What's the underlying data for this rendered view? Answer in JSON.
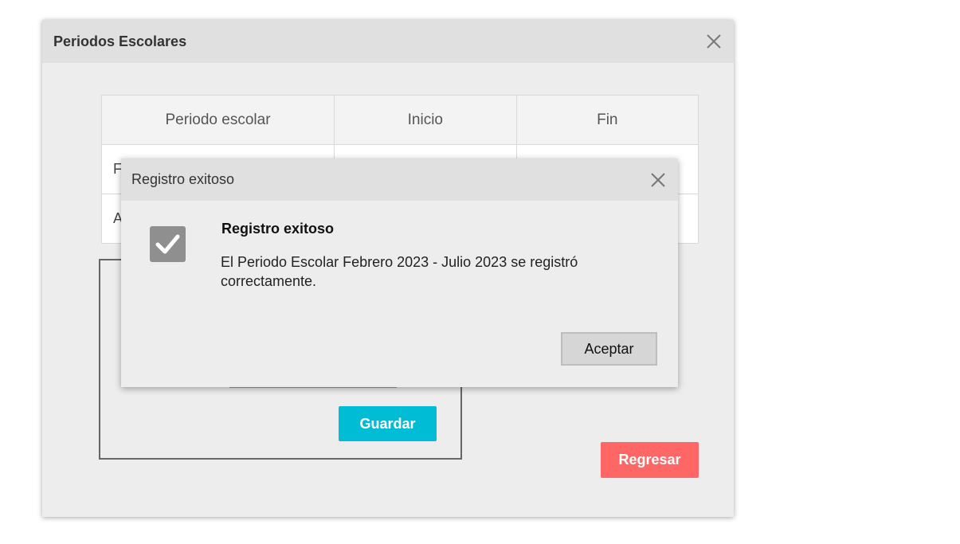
{
  "main_window": {
    "title": "Periodos Escolares",
    "close_icon": "close-icon",
    "table": {
      "headers": [
        "Periodo escolar",
        "Inicio",
        "Fin"
      ],
      "rows": [
        [
          "F",
          "",
          ""
        ],
        [
          "A",
          "",
          ""
        ]
      ]
    },
    "guardar_label": "Guardar",
    "regresar_label": "Regresar"
  },
  "dialog": {
    "title": "Registro exitoso",
    "close_icon": "close-icon",
    "check_icon": "checkbox-checked-icon",
    "message_title": "Registro exitoso",
    "message_body": "El Periodo Escolar Febrero 2023 - Julio 2023 se registró correctamente.",
    "accept_label": "Aceptar"
  },
  "colors": {
    "guardar": "#00bcd4",
    "regresar": "#ff6666",
    "header_bg": "#e0e0e0",
    "window_bg": "#ededed"
  }
}
